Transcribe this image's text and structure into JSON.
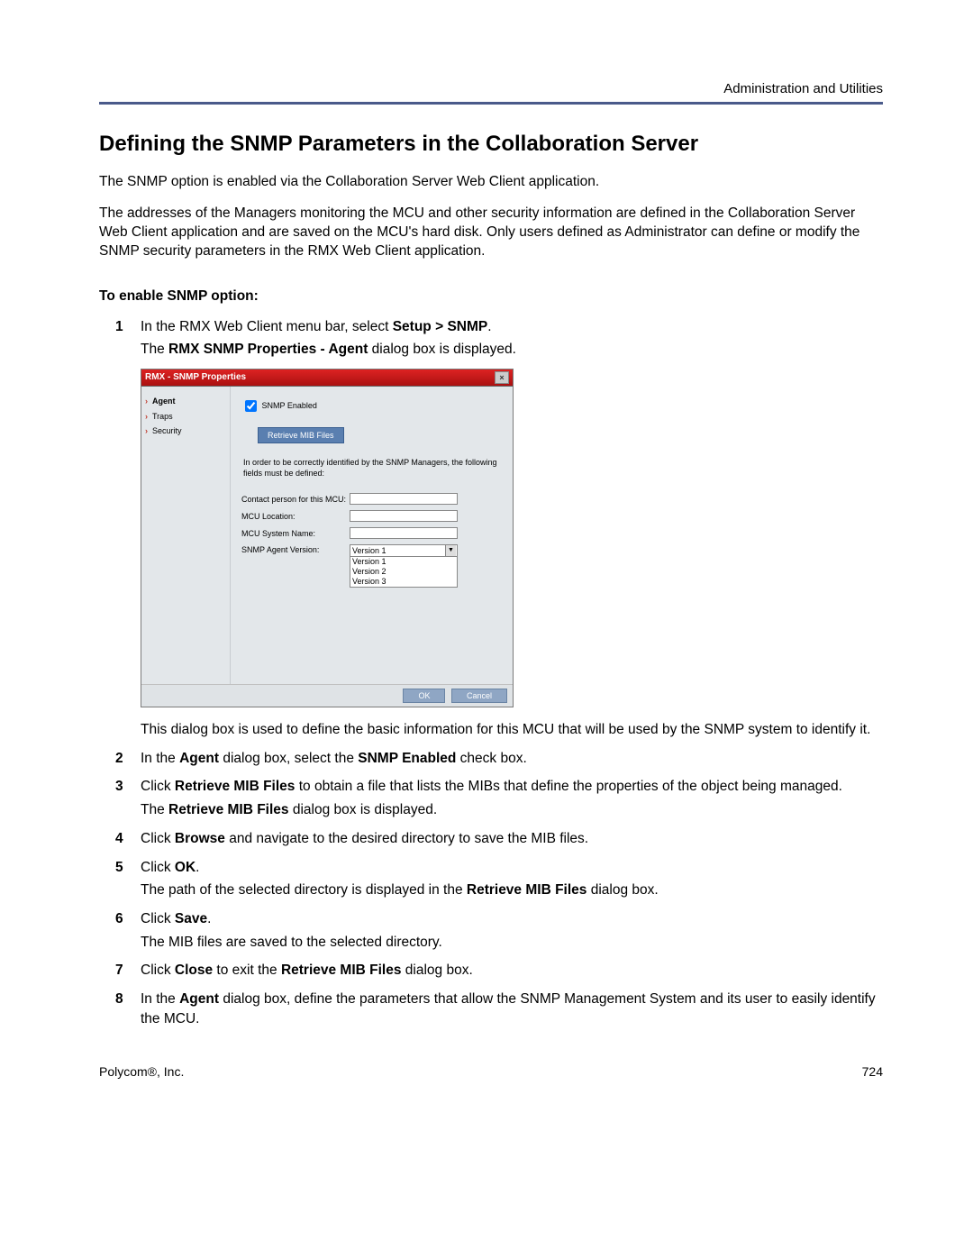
{
  "header": {
    "right": "Administration and Utilities"
  },
  "title": "Defining the SNMP Parameters in the Collaboration Server",
  "intro1": "The SNMP option is enabled via the Collaboration Server Web Client application.",
  "intro2": "The addresses of the Managers monitoring the MCU and other security information are defined in the Collaboration Server Web Client application and are saved on the MCU's hard disk. Only users defined as Administrator can define or modify the SNMP security parameters in the RMX Web Client application.",
  "subhead": "To enable SNMP option:",
  "steps": {
    "s1_pre": "In the RMX Web Client menu bar, select ",
    "s1_b1": "Setup > SNMP",
    "s1_post": ".",
    "s1_para_pre": "The ",
    "s1_para_b": "RMX SNMP Properties - Agent",
    "s1_para_post": " dialog box is displayed.",
    "after_dlg": "This dialog box is used to define the basic information for this MCU that will be used by the SNMP system to identify it.",
    "s2_pre": "In the ",
    "s2_b1": "Agent",
    "s2_mid": " dialog box, select the ",
    "s2_b2": "SNMP Enabled",
    "s2_post": " check box.",
    "s3_pre": "Click ",
    "s3_b1": "Retrieve MIB Files",
    "s3_post": " to obtain a file that lists the MIBs that define the properties of the object being managed.",
    "s3_para_pre": "The ",
    "s3_para_b": "Retrieve MIB Files",
    "s3_para_post": " dialog box is displayed.",
    "s4_pre": "Click ",
    "s4_b1": "Browse",
    "s4_post": " and navigate to the desired directory to save the MIB files.",
    "s5_pre": "Click ",
    "s5_b1": "OK",
    "s5_post": ".",
    "s5_para_pre": "The path of the selected directory is displayed in the ",
    "s5_para_b": "Retrieve MIB Files",
    "s5_para_post": " dialog box.",
    "s6_pre": "Click ",
    "s6_b1": "Save",
    "s6_post": ".",
    "s6_para": "The MIB files are saved to the selected directory.",
    "s7_pre": "Click ",
    "s7_b1": "Close",
    "s7_mid": " to exit the ",
    "s7_b2": "Retrieve MIB Files",
    "s7_post": " dialog box.",
    "s8_pre": "In the ",
    "s8_b1": "Agent",
    "s8_post": " dialog box, define the parameters that allow the SNMP Management System and its user to easily identify the MCU."
  },
  "dialog": {
    "title": "RMX - SNMP Properties",
    "nav": {
      "agent": "Agent",
      "traps": "Traps",
      "security": "Security"
    },
    "chk_label": "SNMP Enabled",
    "btn_retrieve": "Retrieve MIB Files",
    "info": "In order to be correctly identified by the SNMP Managers, the following fields must be defined:",
    "f_contact": "Contact person for this MCU:",
    "f_location": "MCU Location:",
    "f_sysname": "MCU System Name:",
    "f_version": "SNMP Agent Version:",
    "sel_value": "Version 1",
    "opts": {
      "o1": "Version 1",
      "o2": "Version 2",
      "o3": "Version 3"
    },
    "ok": "OK",
    "cancel": "Cancel"
  },
  "footer": {
    "left": "Polycom®, Inc.",
    "right": "724"
  }
}
